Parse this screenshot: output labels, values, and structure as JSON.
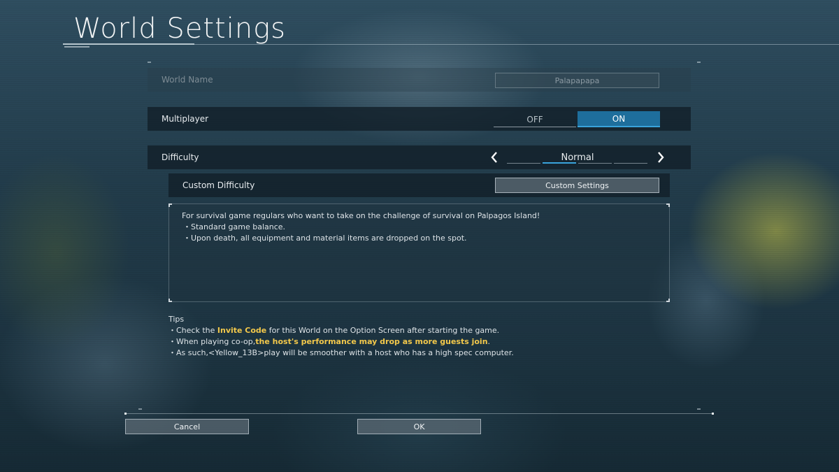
{
  "page": {
    "title": "World Settings"
  },
  "world_name": {
    "label": "World Name",
    "value": "Palapapapa"
  },
  "multiplayer": {
    "label": "Multiplayer",
    "off_label": "OFF",
    "on_label": "ON",
    "selected": "ON"
  },
  "difficulty": {
    "label": "Difficulty",
    "value": "Normal",
    "prev_icon": "chevron-left-icon",
    "next_icon": "chevron-right-icon"
  },
  "custom_difficulty": {
    "label": "Custom Difficulty",
    "button_label": "Custom Settings"
  },
  "description": {
    "intro": "For survival game regulars who want to take on the challenge of survival on Palpagos Island!",
    "bullets": [
      "・Standard game balance.",
      "・Upon death, all equipment and material items are dropped on the spot."
    ]
  },
  "tips": {
    "heading": "Tips",
    "line1_pre": "・Check the ",
    "line1_hl": "Invite Code",
    "line1_post": " for this World on the Option Screen after starting the game.",
    "line2_pre": "・When playing co-op,",
    "line2_hl": "the host's performance may drop as more guests join",
    "line2_post": ".",
    "line3": "・As such,<Yellow_13B>play will be smoother with a host who has a high spec computer."
  },
  "footer": {
    "cancel_label": "Cancel",
    "ok_label": "OK"
  },
  "colors": {
    "accent": "#1e6e9c",
    "accent_line": "#39a3db",
    "highlight": "#f2c84b"
  }
}
